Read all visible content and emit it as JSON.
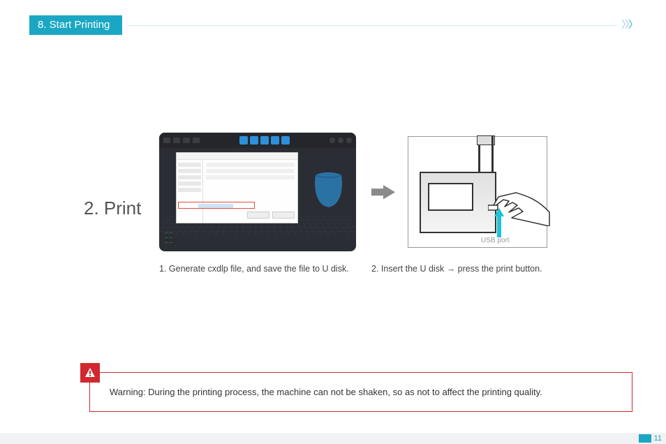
{
  "section_header": "8. Start Printing",
  "step_title": "2. Print",
  "caption_left": "1. Generate cxdlp file, and save the file to  U disk.",
  "caption_right": "2. Insert the  U disk → press the print button.",
  "usb_label": "USB port",
  "warning_text": "Warning: During the printing process, the machine can not be shaken, so as not to affect the printing quality.",
  "page_number": "11"
}
